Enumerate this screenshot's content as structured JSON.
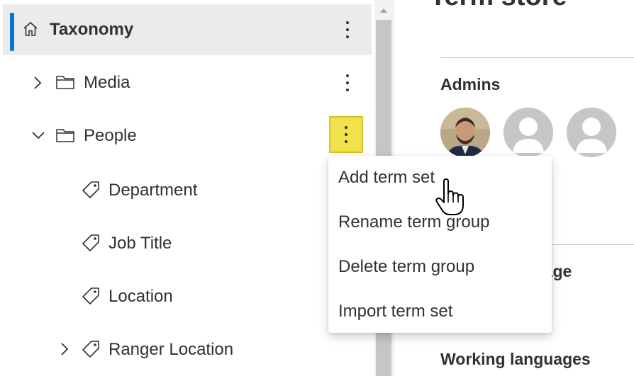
{
  "tree": {
    "root": {
      "label": "Taxonomy",
      "icon": "home-icon"
    },
    "groups": [
      {
        "label": "Media",
        "icon": "folder-icon",
        "expanded": false
      },
      {
        "label": "People",
        "icon": "folder-icon",
        "expanded": true
      }
    ],
    "term_sets": [
      {
        "label": "Department",
        "icon": "tag-icon"
      },
      {
        "label": "Job Title",
        "icon": "tag-icon"
      },
      {
        "label": "Location",
        "icon": "tag-icon"
      },
      {
        "label": "Ranger Location",
        "icon": "tag-icon",
        "expandable": true
      }
    ]
  },
  "context_menu": {
    "items": [
      {
        "label": "Add term set"
      },
      {
        "label": "Rename term group"
      },
      {
        "label": "Delete term group"
      },
      {
        "label": "Import term set"
      }
    ]
  },
  "details": {
    "title": "Term store",
    "admins_heading": "Admins",
    "language_heading_partial": "Default language",
    "working_languages_heading": "Working languages"
  },
  "colors": {
    "accent": "#0078d4",
    "selected_bg": "#edebe9",
    "highlight": "#f1e14a",
    "text": "#323130"
  }
}
